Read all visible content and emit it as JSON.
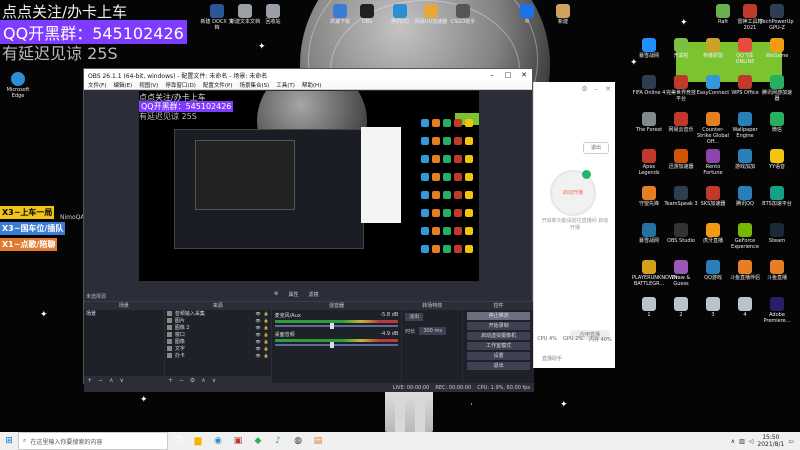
{
  "overlay": {
    "line1": "点点关注/办卡上车",
    "line2": "QQ开黑群：545102426",
    "line3": "有延迟见谅 25S"
  },
  "side_tags": [
    {
      "text": "X3~上车一局",
      "color": "#f0c419"
    },
    {
      "text": "X3~国车位/插队",
      "color": "#3a7bd5"
    },
    {
      "text": "X1~点歌/陪聊",
      "color": "#e07a2e"
    }
  ],
  "side_note": "NimoQAQ进入直播间",
  "desktop_icons_left": [
    {
      "label": "Microsoft Edge",
      "color": "#2b8fd6"
    }
  ],
  "desktop_icons_top": [
    {
      "label": "新建 DOCX 文档",
      "color": "#2b5797"
    },
    {
      "label": "新建文本文档",
      "color": "#9aa0a6"
    },
    {
      "label": "回收站",
      "color": "#9aa0a6"
    },
    {
      "label": "高速下载",
      "color": "#3a7bd5"
    },
    {
      "label": "OBS",
      "color": "#222"
    },
    {
      "label": "腾讯QQ",
      "color": "#2b8fd6"
    },
    {
      "label": "网易UU加速器",
      "color": "#e9a63a"
    },
    {
      "label": "CSGO助手",
      "color": "#555"
    },
    {
      "label": "N",
      "color": "#1a73e8"
    },
    {
      "label": "新建",
      "color": "#d0a060"
    },
    {
      "label": "Raft",
      "color": "#6ab04c"
    },
    {
      "label": "雷神工具箱2021",
      "color": "#c0392b"
    },
    {
      "label": "TechPowerUp GPU-Z",
      "color": "#2c3e50"
    }
  ],
  "desktop_icons_right": [
    {
      "label": "暴雪战网",
      "color": "#1e90ff"
    },
    {
      "label": "开黑啦",
      "color": "#7ac143"
    },
    {
      "label": "英雄联盟",
      "color": "#c9a227"
    },
    {
      "label": "QQ飞车 ONLINE",
      "color": "#e74c3c"
    },
    {
      "label": "WeGame",
      "color": "#f39c12"
    },
    {
      "label": "FIFA Online 4",
      "color": "#2c3e50"
    },
    {
      "label": "完美世界竞技平台",
      "color": "#c0392b"
    },
    {
      "label": "EasyConnect",
      "color": "#3498db"
    },
    {
      "label": "WPS Office",
      "color": "#c0392b"
    },
    {
      "label": "腾讯网游加速器",
      "color": "#27ae60"
    },
    {
      "label": "The Forest",
      "color": "#7f8c8d"
    },
    {
      "label": "网易云音乐",
      "color": "#c0392b"
    },
    {
      "label": "Counter-Strike Global Off...",
      "color": "#e67e22"
    },
    {
      "label": "Wallpaper Engine",
      "color": "#2980b9"
    },
    {
      "label": "微信",
      "color": "#27ae60"
    },
    {
      "label": "Apex Legends",
      "color": "#c0392b"
    },
    {
      "label": "迅游加速器",
      "color": "#d35400"
    },
    {
      "label": "Rento Fortune",
      "color": "#8e44ad"
    },
    {
      "label": "游戏加加",
      "color": "#2980b9"
    },
    {
      "label": "YY语音",
      "color": "#f1c40f"
    },
    {
      "label": "守望先锋",
      "color": "#e67e22"
    },
    {
      "label": "TeamSpeak 3",
      "color": "#2c3e50"
    },
    {
      "label": "SKS加速器",
      "color": "#c0392b"
    },
    {
      "label": "腾讯QQ",
      "color": "#2980b9"
    },
    {
      "label": "BTS加速平台",
      "color": "#16a085"
    },
    {
      "label": "暴雪战网",
      "color": "#2471a3"
    },
    {
      "label": "OBS Studio",
      "color": "#333"
    },
    {
      "label": "虎牙直播",
      "color": "#f39c12"
    },
    {
      "label": "GeForce Experience",
      "color": "#76b900"
    },
    {
      "label": "Steam",
      "color": "#1b2838"
    },
    {
      "label": "PLAYERUNKNOWN BATTLEGR...",
      "color": "#d4a017"
    },
    {
      "label": "Draw & Guess",
      "color": "#9b59b6"
    },
    {
      "label": "QQ游戏",
      "color": "#2980b9"
    },
    {
      "label": "斗鱼直播伴侣",
      "color": "#e67e22"
    },
    {
      "label": "斗鱼直播",
      "color": "#e67e22"
    },
    {
      "label": "1",
      "color": "#bdc3c7"
    },
    {
      "label": "2",
      "color": "#bdc3c7"
    },
    {
      "label": "3",
      "color": "#bdc3c7"
    },
    {
      "label": "4",
      "color": "#bdc3c7"
    },
    {
      "label": "Adobe Premiere...",
      "color": "#2c1c6b"
    }
  ],
  "obs": {
    "title": "OBS 26.1.1 (64-bit, windows) - 配置文件: 未命名 - 场景: 未命名",
    "menu": [
      "文件(F)",
      "编辑(E)",
      "视图(V)",
      "停靠窗口(D)",
      "配置文件(P)",
      "场景集合(S)",
      "工具(T)",
      "帮助(H)"
    ],
    "scene_label": "未选择源",
    "tabs": [
      "属性",
      "滤镜"
    ],
    "docks": {
      "scenes": {
        "header": "场景",
        "items": [
          "场景"
        ]
      },
      "sources": {
        "header": "来源",
        "items": [
          "音频输入采集",
          "图片",
          "图像 2",
          "窗口",
          "图像",
          "文字",
          "办卡"
        ]
      },
      "mixer": {
        "header": "混音器",
        "channels": [
          {
            "name": "麦克风/Aux",
            "value": "-5.8 dB"
          },
          {
            "name": "桌面音频",
            "value": "-4.9 dB"
          }
        ]
      },
      "transitions": {
        "header": "转场特效",
        "mode": "淡出",
        "duration_label": "时长",
        "duration": "300 ms"
      },
      "controls": {
        "header": "控件",
        "buttons": [
          "停止推流",
          "开始录制",
          "启动虚拟摄像机",
          "工作室模式",
          "设置",
          "退出"
        ]
      }
    },
    "status": [
      "LIVE: 00:00:00",
      "REC: 00:00:00",
      "CPU: 1.9%, 60.00 fps"
    ]
  },
  "app": {
    "btn": "退出",
    "circle": "启动开播",
    "hint": "开启新功能请前往直播间 启动开播",
    "foot": [
      "CPU 4%",
      "GPU 2%",
      "内存 40%"
    ],
    "pill": "应用直播",
    "foot2": "直播助手"
  },
  "taskbar": {
    "search_placeholder": "在这里输入你要搜索的内容",
    "time": "15:50",
    "date": "2021/8/1"
  }
}
